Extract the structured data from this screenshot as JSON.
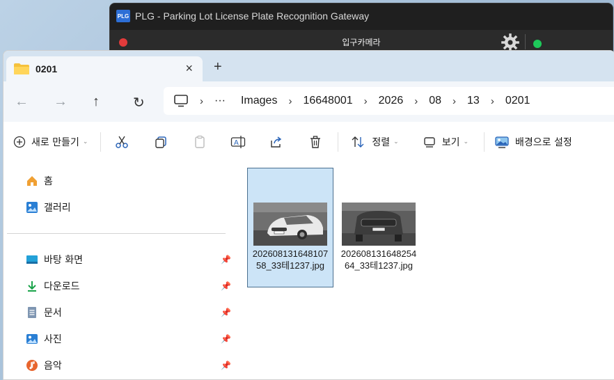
{
  "plg": {
    "logo": "PLG",
    "title": "PLG - Parking Lot License Plate Recognition Gateway",
    "camera_label": "입구카메라",
    "status_left_color": "#e23b3b",
    "status_right_color": "#1ec95a"
  },
  "explorer": {
    "tab": {
      "title": "0201",
      "close": "×",
      "new_tab": "+"
    },
    "nav": {
      "back": "←",
      "forward": "→",
      "up": "↑",
      "refresh": "↻"
    },
    "breadcrumb": {
      "more": "···",
      "items": [
        "Images",
        "16648001",
        "2026",
        "08",
        "13",
        "0201"
      ]
    },
    "commands": {
      "new": "새로 만들기",
      "sort": "정렬",
      "view": "보기",
      "set_background": "배경으로 설정"
    },
    "sidebar": {
      "home": "홈",
      "gallery": "갤러리",
      "pinned": [
        {
          "label": "바탕 화면",
          "icon": "desktop-icon"
        },
        {
          "label": "다운로드",
          "icon": "download-icon"
        },
        {
          "label": "문서",
          "icon": "document-icon"
        },
        {
          "label": "사진",
          "icon": "pictures-icon"
        },
        {
          "label": "음악",
          "icon": "music-icon"
        }
      ]
    },
    "files": [
      {
        "name": "20260813164810758_33테1237.jpg",
        "selected": true
      },
      {
        "name": "20260813164825464_33테1237.jpg",
        "selected": false
      }
    ]
  }
}
